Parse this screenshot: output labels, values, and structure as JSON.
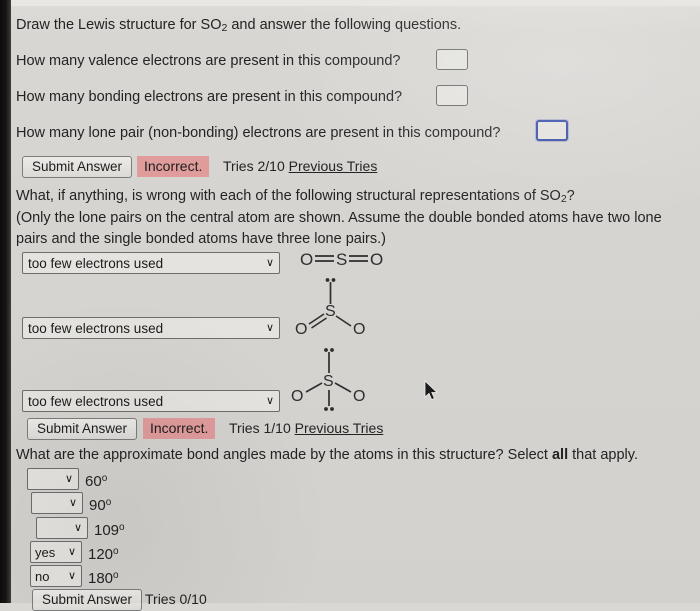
{
  "prompt": {
    "line1_a": "Draw the Lewis structure for SO",
    "line1_sub": "2",
    "line1_b": " and answer the following questions.",
    "q1": "How many valence electrons are present in this compound?",
    "q2": "How many bonding electrons are present in this compound?",
    "q3": "How many lone pair (non-bonding) electrons are present in this compound?",
    "q1_value": "",
    "q2_value": "",
    "q3_value": ""
  },
  "part1": {
    "submit_label": "Submit Answer",
    "status": "Incorrect.",
    "tries": "Tries 2/10",
    "previous_tries": "Previous Tries",
    "status_color": "#e09b9b"
  },
  "part2": {
    "question_a": "What, if anything, is wrong with each of the following structural representations of SO",
    "question_sub": "2",
    "question_b": "?",
    "note_line1": "(Only the lone pairs on the central atom are shown. Assume the double bonded atoms have two lone",
    "note_line2": "pairs and the single bonded atoms have three lone pairs.)",
    "dropdowns": [
      {
        "value": "too few electrons used"
      },
      {
        "value": "too few electrons used"
      },
      {
        "value": "too few electrons used"
      }
    ],
    "structures": [
      {
        "name": "linear-double-double",
        "atoms": [
          "O",
          "S",
          "O"
        ],
        "bonds": [
          "double",
          "double"
        ],
        "lone_pairs_on_center": 0
      },
      {
        "name": "bent-double-single-one-lone-pair",
        "atoms": [
          "O",
          "S",
          "O"
        ],
        "bonds": [
          "double",
          "single"
        ],
        "lone_pairs_on_center": 1
      },
      {
        "name": "bent-single-single-two-lone-pairs",
        "atoms": [
          "O",
          "S",
          "O"
        ],
        "bonds": [
          "single",
          "single"
        ],
        "lone_pairs_on_center": 2
      }
    ],
    "submit_label": "Submit Answer",
    "status": "Incorrect.",
    "tries": "Tries 1/10",
    "previous_tries": "Previous Tries"
  },
  "part3": {
    "question_a": "What are the approximate bond angles made by the atoms in this structure? Select ",
    "question_bold": "all",
    "question_b": " that apply.",
    "angles": [
      {
        "label": "60",
        "degree": "o",
        "value": ""
      },
      {
        "label": "90",
        "degree": "o",
        "value": ""
      },
      {
        "label": "109",
        "degree": "o",
        "value": ""
      },
      {
        "label": "120",
        "degree": "o",
        "value": "yes"
      },
      {
        "label": "180",
        "degree": "o",
        "value": "no"
      }
    ],
    "submit_label": "Submit Answer",
    "tries": "Tries 0/10"
  },
  "icons": {
    "caret": "∨",
    "cursor": "mouse-pointer-icon"
  }
}
